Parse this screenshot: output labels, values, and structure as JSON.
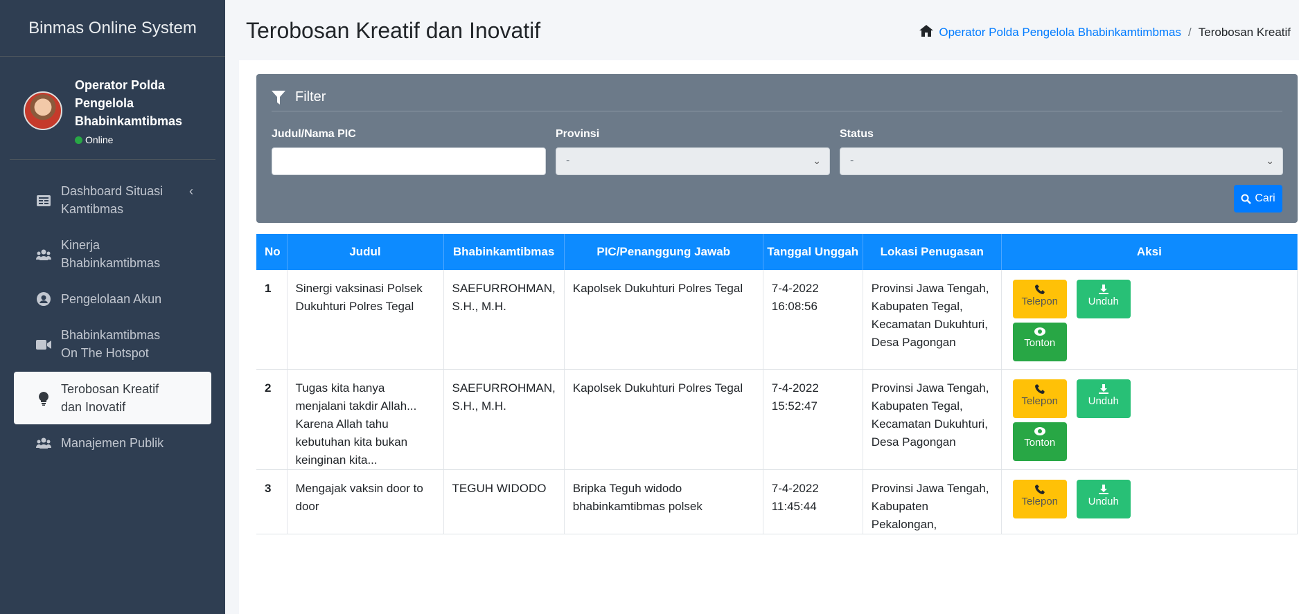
{
  "app": {
    "brand": "Binmas Online System"
  },
  "user": {
    "name": "Operator Polda Pengelola Bhabinkamtibmas",
    "status": "Online"
  },
  "sidebar": {
    "items": [
      {
        "label": "Dashboard Situasi Kamtibmas",
        "icon": "dashboard-icon",
        "has_caret": true
      },
      {
        "label": "Kinerja Bhabinkamtibmas",
        "icon": "users-icon"
      },
      {
        "label": "Pengelolaan Akun",
        "icon": "user-circle-icon"
      },
      {
        "label": "Bhabinkamtibmas On The Hotspot",
        "icon": "video-icon"
      },
      {
        "label": "Terobosan Kreatif dan Inovatif",
        "icon": "lightbulb-icon",
        "active": true
      },
      {
        "label": "Manajemen Publik",
        "icon": "users-icon"
      }
    ]
  },
  "header": {
    "title": "Terobosan Kreatif dan Inovatif",
    "breadcrumb": {
      "home_label": "Operator Polda Pengelola Bhabinkamtimbmas",
      "current": "Terobosan Kreatif"
    }
  },
  "filter": {
    "title": "Filter",
    "judul_label": "Judul/Nama PIC",
    "judul_value": "",
    "provinsi_label": "Provinsi",
    "provinsi_value": "-",
    "status_label": "Status",
    "status_value": "-",
    "search_label": "Cari"
  },
  "table": {
    "headers": [
      "No",
      "Judul",
      "Bhabinkamtibmas",
      "PIC/Penanggung Jawab",
      "Tanggal Unggah",
      "Lokasi Penugasan",
      "Aksi"
    ],
    "rows": [
      {
        "no": "1",
        "judul": "Sinergi vaksinasi Polsek Dukuhturi Polres Tegal",
        "bhabin": "SAEFURROHMAN, S.H., M.H.",
        "pic": "Kapolsek Dukuhturi Polres Tegal",
        "tanggal": "7-4-2022",
        "jam": "16:08:56",
        "lokasi": "Provinsi Jawa Tengah, Kabupaten Tegal, Kecamatan Dukuhturi, Desa Pagongan"
      },
      {
        "no": "2",
        "judul": "Tugas kita hanya menjalani takdir Allah... Karena Allah tahu kebutuhan kita bukan keinginan kita...",
        "bhabin": "SAEFURROHMAN, S.H., M.H.",
        "pic": "Kapolsek Dukuhturi Polres Tegal",
        "tanggal": "7-4-2022",
        "jam": "15:52:47",
        "lokasi": "Provinsi Jawa Tengah, Kabupaten Tegal, Kecamatan Dukuhturi, Desa Pagongan"
      },
      {
        "no": "3",
        "judul": "Mengajak vaksin door to door",
        "bhabin": "TEGUH WIDODO",
        "pic": "Bripka Teguh widodo bhabinkamtibmas polsek",
        "tanggal": "7-4-2022",
        "jam": "11:45:44",
        "lokasi": "Provinsi Jawa Tengah, Kabupaten Pekalongan,"
      }
    ],
    "actions": {
      "telepon": "Telepon",
      "unduh": "Unduh",
      "tonton": "Tonton"
    }
  },
  "colors": {
    "sidebar": "#2f3e52",
    "primary": "#0d8bff",
    "filter_bg": "#6c7a89",
    "telepon": "#ffc107",
    "unduh": "#28c076",
    "tonton": "#28a745"
  }
}
